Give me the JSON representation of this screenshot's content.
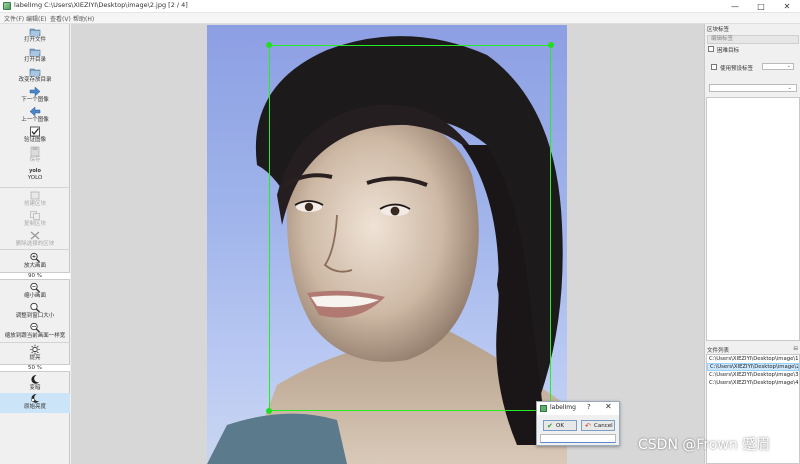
{
  "window": {
    "title": "labelImg C:\\Users\\XIEZIYI\\Desktop\\image\\2.jpg [2 / 4]",
    "controls": {
      "minimize": "—",
      "maximize": "□",
      "close": "✕"
    }
  },
  "menu": [
    {
      "label": "文件(F)"
    },
    {
      "label": "编辑(E)"
    },
    {
      "label": "查看(V)"
    },
    {
      "label": "帮助(H)"
    }
  ],
  "toolbar": {
    "items": [
      {
        "label": "打开文件",
        "icon": "open-file-icon"
      },
      {
        "label": "打开目录",
        "icon": "open-dir-icon"
      },
      {
        "label": "改变存放目录",
        "icon": "change-save-dir-icon"
      },
      {
        "label": "下一个图像",
        "icon": "next-image-icon"
      },
      {
        "label": "上一个图像",
        "icon": "prev-image-icon"
      },
      {
        "label": "验证图像",
        "icon": "verify-image-icon"
      },
      {
        "label": "保存",
        "icon": "save-icon"
      },
      {
        "label": "YOLO",
        "icon": "format-icon",
        "icon_text": "yolo"
      },
      {
        "label": "创建区块",
        "icon": "create-box-icon"
      },
      {
        "label": "复制区块",
        "icon": "duplicate-box-icon"
      },
      {
        "label": "删除选择的区块",
        "icon": "delete-box-icon"
      },
      {
        "label": "放大画面",
        "icon": "zoom-in-icon"
      },
      {
        "label": "缩小画面",
        "icon": "zoom-out-icon"
      },
      {
        "label": "调整到窗口大小",
        "icon": "fit-window-icon"
      },
      {
        "label": "缩放到跟当前画面一样宽",
        "icon": "fit-width-icon"
      },
      {
        "label": "提亮",
        "icon": "brightness-icon"
      },
      {
        "label": "变暗",
        "icon": "darken-icon"
      },
      {
        "label": "原始亮度",
        "icon": "original-brightness-icon"
      }
    ],
    "zoom_value": "90 %",
    "brightness_value": "50 %"
  },
  "canvas": {
    "box_color": "#22ee22"
  },
  "dialog": {
    "title": "labelImg",
    "help": "?",
    "close": "✕",
    "ok": "OK",
    "cancel": "Cancel",
    "input_value": ""
  },
  "right_panel": {
    "labels_dock_title": "区块标签",
    "edit_label_button": "编辑标签",
    "difficult_label": "困难目标",
    "use_default_label": "使用预设标签",
    "default_label_value": "",
    "label_filter_value": "",
    "file_list_title": "文件列表",
    "file_list": [
      "C:\\Users\\XIEZIYI\\Desktop\\image\\1.jpg",
      "C:\\Users\\XIEZIYI\\Desktop\\image\\2.jpg",
      "C:\\Users\\XIEZIYI\\Desktop\\image\\3.jpg",
      "C:\\Users\\XIEZIYI\\Desktop\\image\\4.jpg"
    ],
    "selected_file_index": 1
  },
  "watermark": "CSDN @Frown 蹙眉"
}
